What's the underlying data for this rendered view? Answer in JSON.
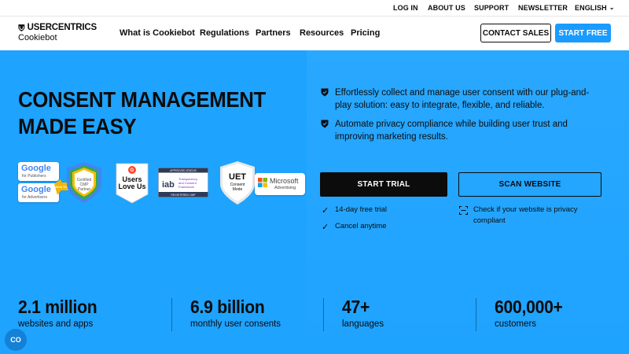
{
  "util_nav": {
    "login": "LOG IN",
    "about": "ABOUT US",
    "support": "SUPPORT",
    "newsletter": "NEWSLETTER",
    "language": "ENGLISH"
  },
  "header": {
    "brand": "USERCENTRICS",
    "product": "Cookiebot",
    "nav": [
      "What is Cookiebot",
      "Regulations",
      "Partners",
      "Resources",
      "Pricing"
    ],
    "contact_label": "CONTACT SALES",
    "start_label": "START FREE"
  },
  "hero": {
    "headline_line1": "CONSENT MANAGEMENT",
    "headline_line2": "MADE EASY",
    "bullets": [
      "Effortlessly collect and manage user consent with our plug-and-play solution: easy to integrate, flexible, and reliable.",
      "Automate privacy compliance while building user trust and improving marketing results."
    ],
    "trial_label": "START TRIAL",
    "scan_label": "SCAN WEBSITE",
    "perks": [
      "14-day free trial",
      "Cancel anytime"
    ],
    "scan_perk_line1": "Check if your website is privacy",
    "scan_perk_line2": "compliant"
  },
  "badges": {
    "google_publishers": "Google",
    "google_publishers_sub": "for Publishers",
    "google_advertisers": "Google",
    "google_advertisers_sub": "for Advertisers",
    "gold_ribbon": "2024 TCF",
    "cmp_line1": "Certified",
    "cmp_line2": "CMP",
    "cmp_line3": "Partner",
    "g2_line1": "Users",
    "g2_line2": "Love Us",
    "iab_status": "APPROVED STATUS",
    "iab_logo": "iab",
    "iab_text": "Transparency and Consent Framework",
    "iab_footer": "REGISTERED CMP",
    "uet_title": "UET",
    "uet_line1": "Consent",
    "uet_line2": "Mode",
    "ms_name": "Microsoft",
    "ms_sub": "Advertising"
  },
  "stats": [
    {
      "value": "2.1 million",
      "label": "websites and apps"
    },
    {
      "value": "6.9 billion",
      "label": "monthly user consents"
    },
    {
      "value": "47+",
      "label": "languages"
    },
    {
      "value": "600,000+",
      "label": "customers"
    }
  ],
  "cookie_fab": "CO",
  "colors": {
    "hero_bg": "#1ea3ff",
    "primary_button": "#1a9bff",
    "text": "#0c0c0c"
  }
}
